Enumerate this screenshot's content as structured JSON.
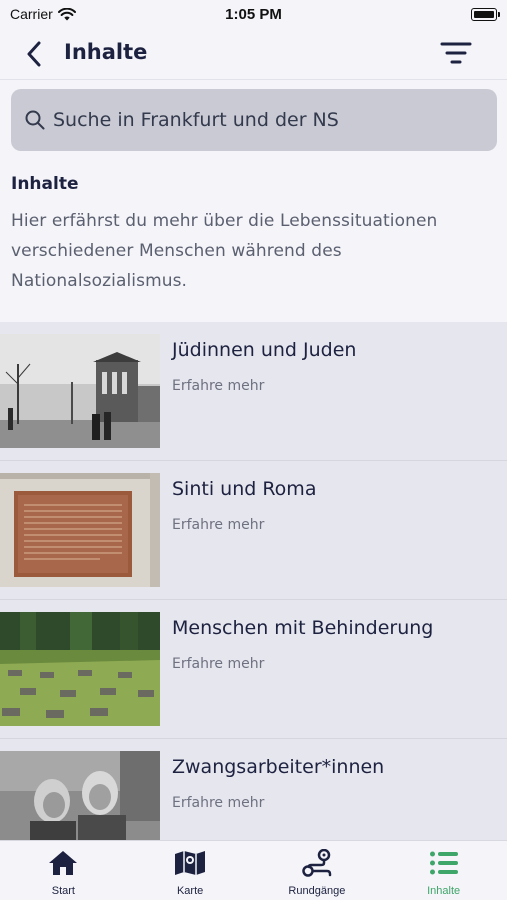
{
  "status_bar": {
    "carrier": "Carrier",
    "time": "1:05 PM"
  },
  "nav": {
    "title": "Inhalte"
  },
  "search": {
    "placeholder": "Suche in Frankfurt und der NS"
  },
  "intro": {
    "heading": "Inhalte",
    "text": "Hier erfährst du mehr über die Lebenssituationen verschiedener Menschen während des Nationalsozialismus."
  },
  "items": [
    {
      "title": "Jüdinnen und Juden",
      "link": "Erfahre mehr"
    },
    {
      "title": "Sinti und Roma",
      "link": "Erfahre mehr"
    },
    {
      "title": "Menschen mit Behinderung",
      "link": "Erfahre mehr"
    },
    {
      "title": "Zwangsarbeiter*innen",
      "link": "Erfahre mehr"
    }
  ],
  "tabs": [
    {
      "label": "Start",
      "icon": "home-icon"
    },
    {
      "label": "Karte",
      "icon": "map-icon"
    },
    {
      "label": "Rundgänge",
      "icon": "route-icon"
    },
    {
      "label": "Inhalte",
      "icon": "list-icon",
      "active": true
    }
  ],
  "colors": {
    "primary": "#1d2240",
    "accent": "#3fa66a",
    "background": "#f4f4f9",
    "search_bg": "#c9cad3"
  }
}
